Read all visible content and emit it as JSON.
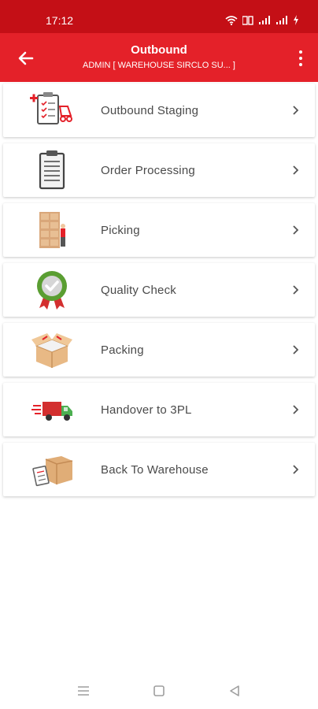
{
  "status_bar": {
    "time": "17:12"
  },
  "app_bar": {
    "title": "Outbound",
    "subtitle": "ADMIN [ WAREHOUSE SIRCLO SU... ]"
  },
  "menu": [
    {
      "label": "Outbound Staging",
      "icon": "outbound-staging-icon"
    },
    {
      "label": "Order Processing",
      "icon": "clipboard-icon"
    },
    {
      "label": "Picking",
      "icon": "picking-shelf-icon"
    },
    {
      "label": "Quality Check",
      "icon": "quality-badge-icon"
    },
    {
      "label": "Packing",
      "icon": "open-box-icon"
    },
    {
      "label": "Handover to 3PL",
      "icon": "delivery-truck-icon"
    },
    {
      "label": "Back To Warehouse",
      "icon": "return-box-icon"
    }
  ],
  "colors": {
    "status_bar": "#c40f16",
    "app_bar": "#e42129",
    "label": "#4a4a4a"
  }
}
